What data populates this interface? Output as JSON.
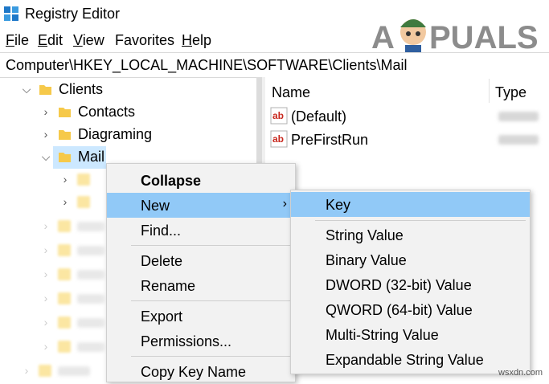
{
  "window": {
    "title": "Registry Editor"
  },
  "menubar": [
    {
      "label": "File",
      "mnemonic": "F",
      "rest": "ile"
    },
    {
      "label": "Edit",
      "mnemonic": "E",
      "rest": "dit"
    },
    {
      "label": "View",
      "mnemonic": "V",
      "rest": "iew"
    },
    {
      "label": "Favorites",
      "mnemonic": "",
      "rest": "Favorites"
    },
    {
      "label": "Help",
      "mnemonic": "H",
      "rest": "elp"
    }
  ],
  "address": "Computer\\HKEY_LOCAL_MACHINE\\SOFTWARE\\Clients\\Mail",
  "tree": {
    "items": [
      {
        "label": "Clients",
        "expanded": true
      },
      {
        "label": "Contacts",
        "expanded": false
      },
      {
        "label": "Diagraming",
        "expanded": false
      },
      {
        "label": "Mail",
        "expanded": true,
        "selected": true
      }
    ]
  },
  "list": {
    "columns": {
      "name": "Name",
      "type": "Type"
    },
    "rows": [
      {
        "name": "(Default)",
        "icon": "string-value-icon"
      },
      {
        "name": "PreFirstRun",
        "icon": "string-value-icon"
      }
    ]
  },
  "context_menu": {
    "collapse": "Collapse",
    "new": "New",
    "new_arrow": "›",
    "find": "Find...",
    "delete": "Delete",
    "rename": "Rename",
    "export": "Export",
    "permissions": "Permissions...",
    "copy_key_name": "Copy Key Name"
  },
  "submenu": {
    "key": "Key",
    "string_value": "String Value",
    "binary_value": "Binary Value",
    "dword": "DWORD (32-bit) Value",
    "qword": "QWORD (64-bit) Value",
    "multi_string": "Multi-String Value",
    "expandable_string": "Expandable String Value"
  },
  "watermark": {
    "logo": "APPUALS",
    "site": "wsxdn.com"
  },
  "colors": {
    "highlight": "#91c9f7",
    "selection": "#cce8ff",
    "menu_bg": "#f2f2f2",
    "folder": "#f6c94a"
  }
}
